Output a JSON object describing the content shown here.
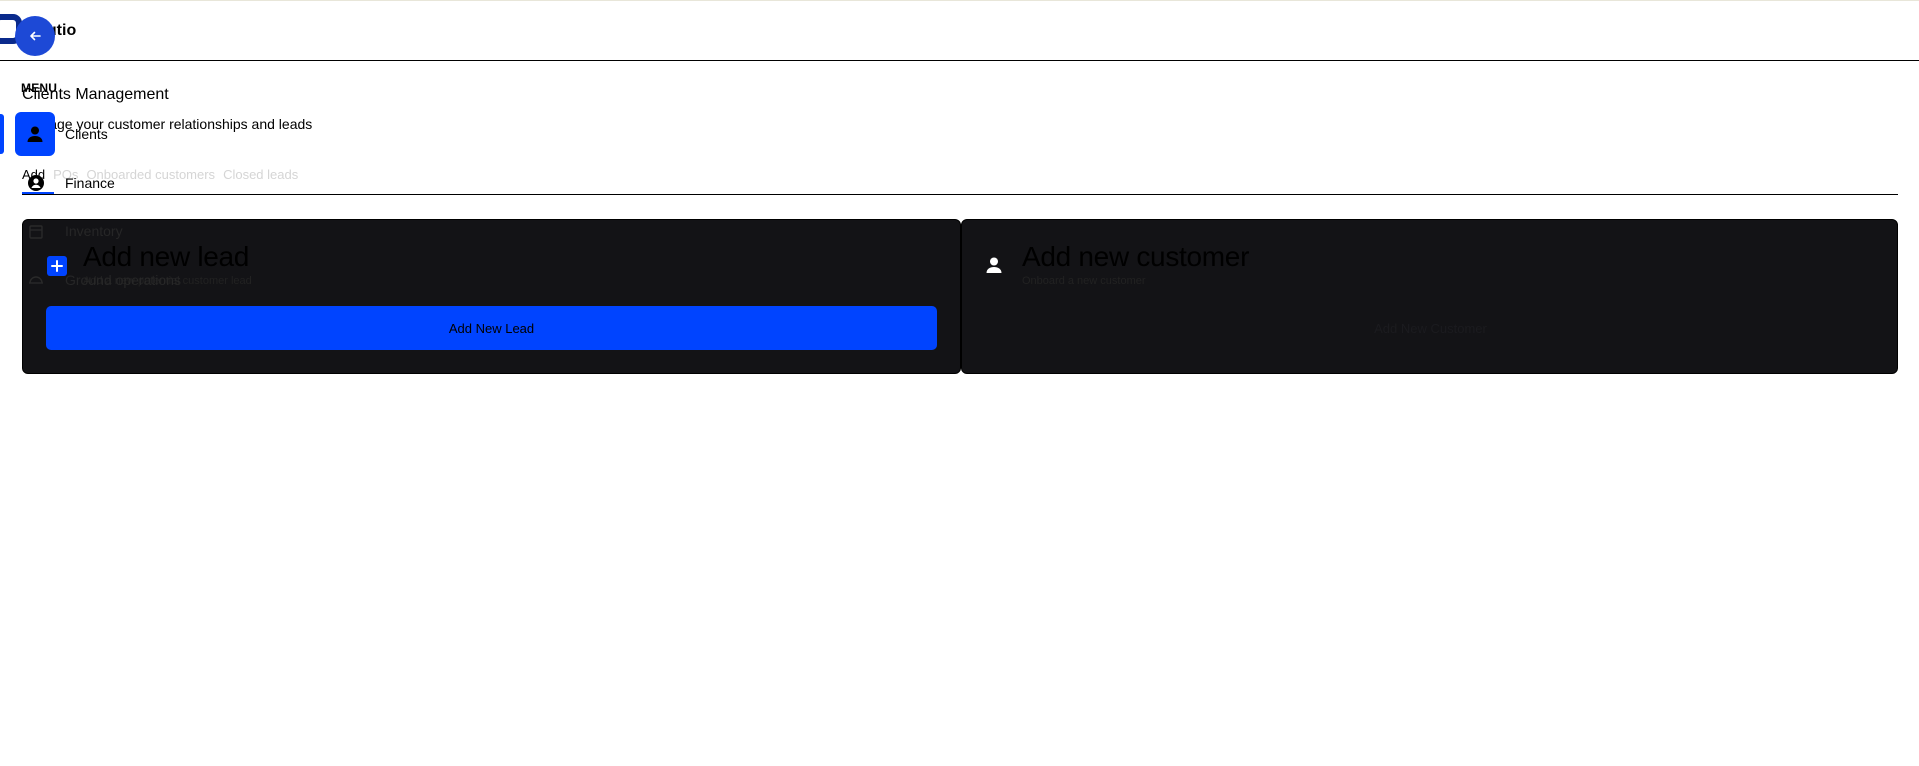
{
  "app": {
    "brand": "autio"
  },
  "sidebar": {
    "menu_label": "MENU",
    "items": [
      {
        "label": "Clients",
        "icon": "person-icon",
        "active": true
      },
      {
        "label": "Finance",
        "icon": "finance-icon",
        "active": false
      },
      {
        "label": "Inventory",
        "icon": "inventory-icon",
        "active": false
      },
      {
        "label": "Ground operations",
        "icon": "ground-operations-icon",
        "active": false
      }
    ]
  },
  "page": {
    "title": "Clients Management",
    "subtitle": "Manage your customer relationships and leads"
  },
  "tabs": [
    {
      "label": "Add",
      "active": true
    },
    {
      "label": "POs",
      "active": false
    },
    {
      "label": "Onboarded customers",
      "active": false
    },
    {
      "label": "Closed leads",
      "active": false
    }
  ],
  "cards": {
    "lead": {
      "title": "Add new lead",
      "description": "Add a new potential customer lead",
      "button": "Add New Lead",
      "icon": "plus-icon"
    },
    "customer": {
      "title": "Add new customer",
      "description": "Onboard a new customer",
      "button": "Add New Customer",
      "icon": "person-icon"
    }
  },
  "colors": {
    "accent": "#0044ff",
    "back_button": "#1d49d6",
    "card_bg": "#131316",
    "logo": "#0a2a8c"
  }
}
